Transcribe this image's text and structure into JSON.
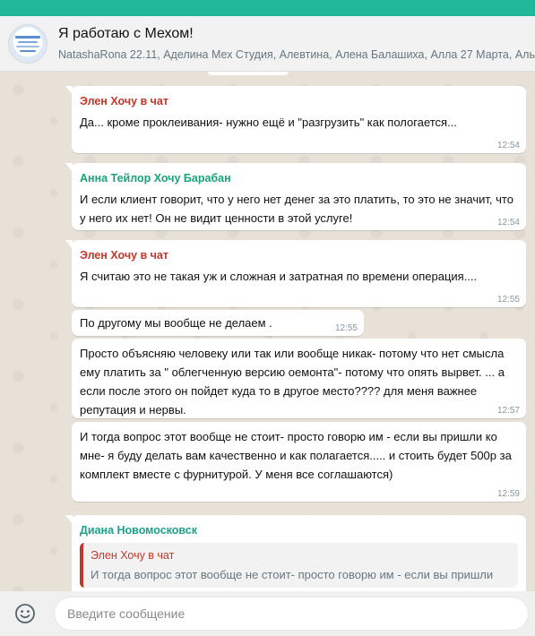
{
  "colors": {
    "accent": "#1fb99a",
    "sender_red": "#c0392b",
    "sender_green": "#1aa37a",
    "sender_teal": "#1aa38a"
  },
  "header": {
    "title": "Я работаю с Мехом!",
    "members": "NatashaRona 22.11, Аделина Мех Студия, Алевтина, Алена Балашиха, Алла 27 Марта, Аль"
  },
  "messages": [
    {
      "sender": "Элен Хочу в чат",
      "text": "Да... кроме проклеивания- нужно ещё и \"разгрузить\" как пологается...",
      "time": "12:54"
    },
    {
      "sender": "Анна Тейлор Хочу Барабан",
      "text": "И если клиент говорит, что у него нет денег за это платить, то это не значит, что у него их нет! Он не видит ценности в этой услуге!",
      "time": "12:54"
    },
    {
      "sender": "Элен Хочу в чат",
      "text": "Я считаю это не такая уж и сложная и затратная по времени операция....",
      "time": "12:55"
    },
    {
      "text": "По другому мы вообще не делаем .",
      "time": "12:55"
    },
    {
      "text": "Просто объясняю человеку или так или вообще никак- потому что нет смысла ему платить за \" облегченную версию оемонта\"- потому что опять вырвет. ... а  если после этого он пойдет куда то в другое место???? для меня важнее репутация и нервы.",
      "time": "12:57"
    },
    {
      "text": "И тогда  вопрос этот вообще не стоит- просто говорю им - если вы пришли ко мне- я буду делать вам качественно и как полагается..... и стоить будет 500р за комплект вместе с фурнитурой. У меня все соглашаются)",
      "time": "12:59"
    },
    {
      "sender": "Диана Новомосковск",
      "quote": {
        "sender": "Элен Хочу в чат",
        "text": "И тогда вопрос этот вообще не стоит- просто говорю им - если вы пришли"
      }
    }
  ],
  "footer": {
    "emoji_icon": "smiley-icon",
    "placeholder": "Введите сообщение"
  }
}
